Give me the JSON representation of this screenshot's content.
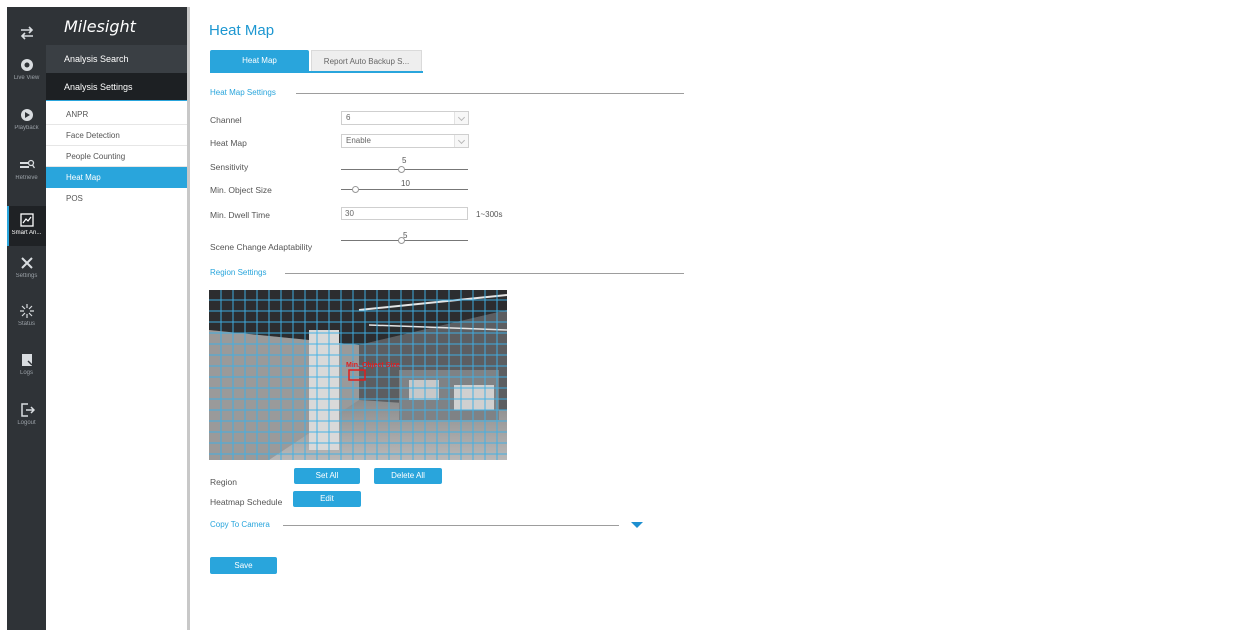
{
  "brand": {
    "logo_text": "Milesight"
  },
  "rail": [
    {
      "icon": "switch-arrows-icon",
      "label": ""
    },
    {
      "icon": "live-view-icon",
      "label": "Live View"
    },
    {
      "icon": "playback-icon",
      "label": "Playback"
    },
    {
      "icon": "retrieve-icon",
      "label": "Retrieve"
    },
    {
      "icon": "smart-analysis-icon",
      "label": "Smart An..."
    },
    {
      "icon": "settings-icon",
      "label": "Settings"
    },
    {
      "icon": "status-icon",
      "label": "Status"
    },
    {
      "icon": "logs-icon",
      "label": "Logs"
    },
    {
      "icon": "logout-icon",
      "label": "Logout"
    }
  ],
  "menu": {
    "group1": "Analysis Search",
    "group2": "Analysis Settings",
    "items": [
      "ANPR",
      "Face Detection",
      "People Counting",
      "Heat Map",
      "POS"
    ],
    "active_item": "Heat Map"
  },
  "page": {
    "title": "Heat Map",
    "tabs": [
      "Heat Map",
      "Report Auto Backup S..."
    ]
  },
  "heatmap_settings": {
    "section_title": "Heat Map Settings",
    "channel_label": "Channel",
    "channel_value": "6",
    "heatmap_label": "Heat Map",
    "heatmap_value": "Enable",
    "sensitivity_label": "Sensitivity",
    "sensitivity_value": "5",
    "min_object_size_label": "Min. Object Size",
    "min_object_size_value": "10",
    "min_dwell_label": "Min. Dwell Time",
    "min_dwell_value": "30",
    "min_dwell_range": "1~300s",
    "scene_change_label": "Scene Change Adaptability",
    "scene_change_value": "5"
  },
  "region_settings": {
    "section_title": "Region Settings",
    "overlay_label": "Min. Object Size",
    "region_label": "Region",
    "set_all": "Set All",
    "delete_all": "Delete All",
    "schedule_label": "Heatmap Schedule",
    "edit": "Edit"
  },
  "copy_to_camera": "Copy To Camera",
  "save": "Save",
  "colors": {
    "accent": "#29a5dc",
    "grid": "#3fb1e6",
    "overlay": "#e01e1e"
  }
}
